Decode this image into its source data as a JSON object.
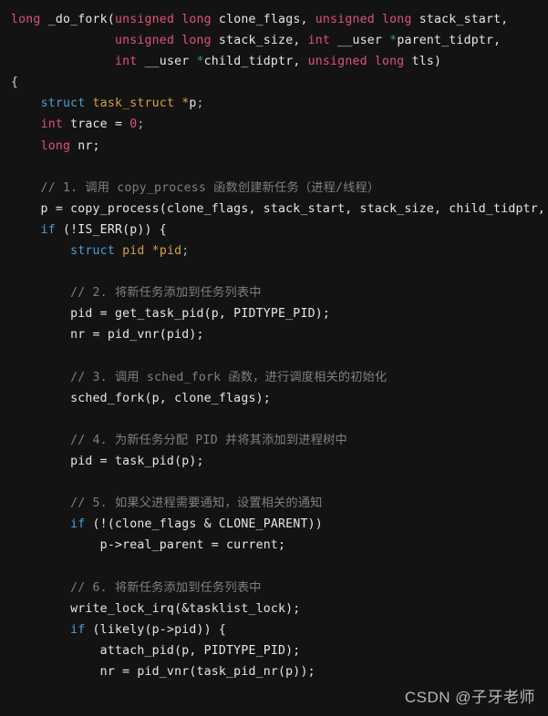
{
  "editor": {
    "background_color": "#131313",
    "language": "C",
    "font_size_px": 13,
    "theme_colors": {
      "keyword_pink": "#e05175",
      "keyword_blue": "#4d9fd6",
      "type_orange": "#d3a04a",
      "comment_gray": "#7f7f7f",
      "plain_text": "#e6e6e6",
      "pointer_teal": "#2f9e8f"
    }
  },
  "watermark": {
    "text": "CSDN @子牙老师"
  },
  "code": {
    "lines": [
      "long _do_fork(unsigned long clone_flags, unsigned long stack_start,",
      "              unsigned long stack_size, int __user *parent_tidptr,",
      "              int __user *child_tidptr, unsigned long tls)",
      "{",
      "    struct task_struct *p;",
      "    int trace = 0;",
      "    long nr;",
      "",
      "    // 1. 调用 copy_process 函数创建新任务（进程/线程）",
      "    p = copy_process(clone_flags, stack_start, stack_size, child_tidptr, N",
      "    if (!IS_ERR(p)) {",
      "        struct pid *pid;",
      "",
      "        // 2. 将新任务添加到任务列表中",
      "        pid = get_task_pid(p, PIDTYPE_PID);",
      "        nr = pid_vnr(pid);",
      "",
      "        // 3. 调用 sched_fork 函数，进行调度相关的初始化",
      "        sched_fork(p, clone_flags);",
      "",
      "        // 4. 为新任务分配 PID 并将其添加到进程树中",
      "        pid = task_pid(p);",
      "",
      "        // 5. 如果父进程需要通知，设置相关的通知",
      "        if (!(clone_flags & CLONE_PARENT))",
      "            p->real_parent = current;",
      "",
      "        // 6. 将新任务添加到任务列表中",
      "        write_lock_irq(&tasklist_lock);",
      "        if (likely(p->pid)) {",
      "            attach_pid(p, PIDTYPE_PID);",
      "            nr = pid_vnr(task_pid_nr(p));"
    ],
    "function_name": "_do_fork",
    "comment_labels": [
      "// 1. 调用 copy_process 函数创建新任务（进程/线程）",
      "// 2. 将新任务添加到任务列表中",
      "// 3. 调用 sched_fork 函数，进行调度相关的初始化",
      "// 4. 为新任务分配 PID 并将其添加到进程树中",
      "// 5. 如果父进程需要通知，设置相关的通知",
      "// 6. 将新任务添加到任务列表中"
    ],
    "rendered": [
      {
        "i": 0,
        "segs": [
          {
            "t": "long",
            "c": "kw"
          },
          {
            "t": " _do_fork(",
            "c": "pln"
          },
          {
            "t": "unsigned long",
            "c": "kw"
          },
          {
            "t": " clone_flags, ",
            "c": "pln"
          },
          {
            "t": "unsigned long",
            "c": "kw"
          },
          {
            "t": " stack_start,",
            "c": "pln"
          }
        ]
      },
      {
        "i": 1,
        "segs": [
          {
            "t": "              ",
            "c": "pln"
          },
          {
            "t": "unsigned long",
            "c": "kw"
          },
          {
            "t": " stack_size, ",
            "c": "pln"
          },
          {
            "t": "int",
            "c": "kw"
          },
          {
            "t": " __user ",
            "c": "pln"
          },
          {
            "t": "*",
            "c": "star2"
          },
          {
            "t": "parent_tidptr,",
            "c": "pln"
          }
        ]
      },
      {
        "i": 2,
        "segs": [
          {
            "t": "              ",
            "c": "pln"
          },
          {
            "t": "int",
            "c": "kw"
          },
          {
            "t": " __user ",
            "c": "pln"
          },
          {
            "t": "*",
            "c": "star2"
          },
          {
            "t": "child_tidptr, ",
            "c": "pln"
          },
          {
            "t": "unsigned long",
            "c": "kw"
          },
          {
            "t": " tls)",
            "c": "pln"
          }
        ]
      },
      {
        "i": 3,
        "segs": [
          {
            "t": "{",
            "c": "pnc"
          }
        ]
      },
      {
        "i": 4,
        "segs": [
          {
            "t": "    ",
            "c": "pln"
          },
          {
            "t": "struct",
            "c": "kw2"
          },
          {
            "t": " ",
            "c": "pln"
          },
          {
            "t": "task_struct",
            "c": "typ"
          },
          {
            "t": " ",
            "c": "pln"
          },
          {
            "t": "*",
            "c": "star"
          },
          {
            "t": "p",
            "c": "pln"
          },
          {
            "t": ";",
            "c": "semi"
          }
        ]
      },
      {
        "i": 5,
        "segs": [
          {
            "t": "    ",
            "c": "pln"
          },
          {
            "t": "int",
            "c": "kw"
          },
          {
            "t": " trace = ",
            "c": "pln"
          },
          {
            "t": "0",
            "c": "num"
          },
          {
            "t": ";",
            "c": "semi"
          }
        ]
      },
      {
        "i": 6,
        "segs": [
          {
            "t": "    ",
            "c": "pln"
          },
          {
            "t": "long",
            "c": "kw"
          },
          {
            "t": " nr;",
            "c": "pln"
          }
        ]
      },
      {
        "i": 7,
        "segs": []
      },
      {
        "i": 8,
        "segs": [
          {
            "t": "    // 1. 调用 copy_process 函数创建新任务（进程/线程）",
            "c": "cmt"
          }
        ]
      },
      {
        "i": 9,
        "segs": [
          {
            "t": "    p = copy_process(clone_flags, stack_start, stack_size, child_tidptr, N",
            "c": "pln"
          }
        ]
      },
      {
        "i": 10,
        "segs": [
          {
            "t": "    ",
            "c": "pln"
          },
          {
            "t": "if",
            "c": "kw2"
          },
          {
            "t": " (!IS_ERR(p)) {",
            "c": "pln"
          }
        ]
      },
      {
        "i": 11,
        "segs": [
          {
            "t": "        ",
            "c": "pln"
          },
          {
            "t": "struct",
            "c": "kw2"
          },
          {
            "t": " ",
            "c": "pln"
          },
          {
            "t": "pid",
            "c": "typ"
          },
          {
            "t": " ",
            "c": "pln"
          },
          {
            "t": "*",
            "c": "star"
          },
          {
            "t": "pid",
            "c": "typ"
          },
          {
            "t": ";",
            "c": "semi"
          }
        ]
      },
      {
        "i": 12,
        "segs": []
      },
      {
        "i": 13,
        "segs": [
          {
            "t": "        // 2. 将新任务添加到任务列表中",
            "c": "cmt"
          }
        ]
      },
      {
        "i": 14,
        "segs": [
          {
            "t": "        pid = get_task_pid(p, PIDTYPE_PID);",
            "c": "pln"
          }
        ]
      },
      {
        "i": 15,
        "segs": [
          {
            "t": "        nr = pid_vnr(pid);",
            "c": "pln"
          }
        ]
      },
      {
        "i": 16,
        "segs": []
      },
      {
        "i": 17,
        "segs": [
          {
            "t": "        // 3. 调用 sched_fork 函数，进行调度相关的初始化",
            "c": "cmt"
          }
        ]
      },
      {
        "i": 18,
        "segs": [
          {
            "t": "        sched_fork(p, clone_flags);",
            "c": "pln"
          }
        ]
      },
      {
        "i": 19,
        "segs": []
      },
      {
        "i": 20,
        "segs": [
          {
            "t": "        // 4. 为新任务分配 PID 并将其添加到进程树中",
            "c": "cmt"
          }
        ]
      },
      {
        "i": 21,
        "segs": [
          {
            "t": "        pid = task_pid(p);",
            "c": "pln"
          }
        ]
      },
      {
        "i": 22,
        "segs": []
      },
      {
        "i": 23,
        "segs": [
          {
            "t": "        // 5. 如果父进程需要通知，设置相关的通知",
            "c": "cmt"
          }
        ]
      },
      {
        "i": 24,
        "segs": [
          {
            "t": "        ",
            "c": "pln"
          },
          {
            "t": "if",
            "c": "kw2"
          },
          {
            "t": " (!(clone_flags & CLONE_PARENT))",
            "c": "pln"
          }
        ]
      },
      {
        "i": 25,
        "segs": [
          {
            "t": "            p->real_parent = current;",
            "c": "pln"
          }
        ]
      },
      {
        "i": 26,
        "segs": []
      },
      {
        "i": 27,
        "segs": [
          {
            "t": "        // 6. 将新任务添加到任务列表中",
            "c": "cmt"
          }
        ]
      },
      {
        "i": 28,
        "segs": [
          {
            "t": "        write_lock_irq(&tasklist_lock);",
            "c": "pln"
          }
        ]
      },
      {
        "i": 29,
        "segs": [
          {
            "t": "        ",
            "c": "pln"
          },
          {
            "t": "if",
            "c": "kw2"
          },
          {
            "t": " (likely(p->pid)) {",
            "c": "pln"
          }
        ]
      },
      {
        "i": 30,
        "segs": [
          {
            "t": "            attach_pid(p, PIDTYPE_PID);",
            "c": "pln"
          }
        ]
      },
      {
        "i": 31,
        "segs": [
          {
            "t": "            nr = pid_vnr(task_pid_nr(p));",
            "c": "pln"
          }
        ]
      }
    ]
  }
}
